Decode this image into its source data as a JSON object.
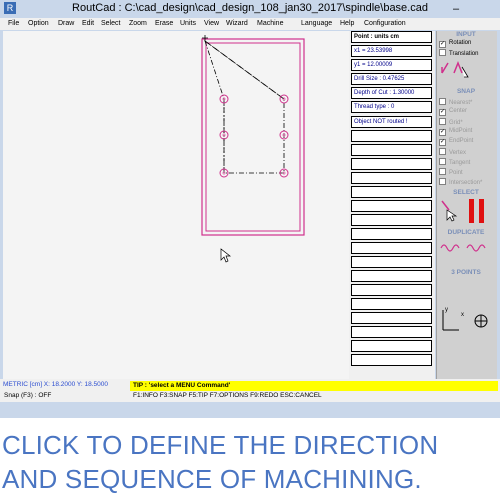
{
  "window": {
    "title": "RoutCad : C:\\cad_design\\cad_design_108_jan30_2017\\spindle\\base.cad",
    "minimize_symbol": "–"
  },
  "menu": [
    "File",
    "Option",
    "Draw",
    "Edit",
    "Select",
    "Zoom",
    "Erase",
    "Units",
    "View",
    "Wizard",
    "Machine",
    "Language",
    "Help",
    "Configuration"
  ],
  "info_panel": {
    "header": "Point : units cm",
    "x1": "x1 = 23.53998",
    "y1": "y1 = 12.00009",
    "drill_size": "Drill Size        : 0.47625",
    "depth_of_cut": "Depth of Cut : 1.30000",
    "thread_type": "Thread type  : 0",
    "object_status": "Object NOT routed !"
  },
  "tool_panel": {
    "input": {
      "title": "INPUT",
      "rotation": "Rotation",
      "translation": "Translation",
      "rotation_checked": true,
      "translation_checked": false
    },
    "snap": {
      "title": "SNAP",
      "options": [
        {
          "label": "Nearest*",
          "checked": false
        },
        {
          "label": "Center",
          "checked": true
        },
        {
          "label": "Grid*",
          "checked": false
        },
        {
          "label": "MidPoint",
          "checked": true
        },
        {
          "label": "EndPoint",
          "checked": true
        },
        {
          "label": "Vertex",
          "checked": false
        },
        {
          "label": "Tangent",
          "checked": false
        },
        {
          "label": "Point",
          "checked": false
        },
        {
          "label": "Intersection*",
          "checked": false
        }
      ]
    },
    "select_title": "SELECT",
    "duplicate_title": "DUPLICATE",
    "three_points_title": "3 POINTS",
    "axis_x": "x",
    "axis_y": "y"
  },
  "status": {
    "metric": "METRIC [cm] X: 18.2000  Y: 18.5000",
    "snap": "Snap (F3) : OFF",
    "tip": "TIP : 'select a MENU Command'",
    "shortcuts": "F1:INFO  F3:SNAP  F5:TIP  F7:OPTIONS  F9:REDO  ESC:CANCEL"
  },
  "colors": {
    "accent": "#4a75c2",
    "part_outline": "#d0308c",
    "tip_background": "#ffff00",
    "toolpath": "#000000"
  },
  "caption": "CLICK TO DEFINE THE DIRECTION\nAND SEQUENCE OF MACHINING."
}
